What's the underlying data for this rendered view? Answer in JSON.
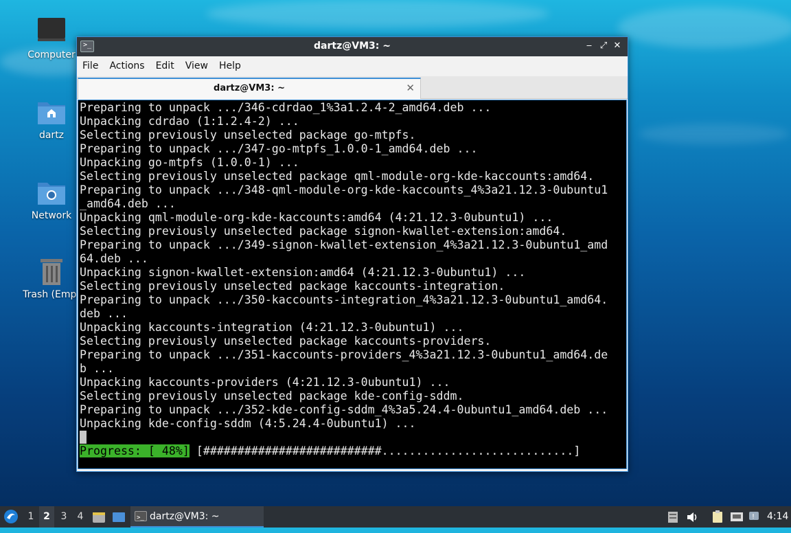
{
  "desktop": {
    "icons": [
      {
        "label": "Computer"
      },
      {
        "label": "dartz"
      },
      {
        "label": "Network"
      },
      {
        "label": "Trash (Empt"
      }
    ]
  },
  "window": {
    "title": "dartz@VM3: ~",
    "menu": [
      "File",
      "Actions",
      "Edit",
      "View",
      "Help"
    ],
    "tab_title": "dartz@VM3: ~",
    "controls": {
      "minimize": "‒",
      "maximize": "⤢",
      "close": "✕"
    }
  },
  "terminal": {
    "lines": [
      "Preparing to unpack .../346-cdrdao_1%3a1.2.4-2_amd64.deb ...",
      "Unpacking cdrdao (1:1.2.4-2) ...",
      "Selecting previously unselected package go-mtpfs.",
      "Preparing to unpack .../347-go-mtpfs_1.0.0-1_amd64.deb ...",
      "Unpacking go-mtpfs (1.0.0-1) ...",
      "Selecting previously unselected package qml-module-org-kde-kaccounts:amd64.",
      "Preparing to unpack .../348-qml-module-org-kde-kaccounts_4%3a21.12.3-0ubuntu1",
      "_amd64.deb ...",
      "Unpacking qml-module-org-kde-kaccounts:amd64 (4:21.12.3-0ubuntu1) ...",
      "Selecting previously unselected package signon-kwallet-extension:amd64.",
      "Preparing to unpack .../349-signon-kwallet-extension_4%3a21.12.3-0ubuntu1_amd",
      "64.deb ...",
      "Unpacking signon-kwallet-extension:amd64 (4:21.12.3-0ubuntu1) ...",
      "Selecting previously unselected package kaccounts-integration.",
      "Preparing to unpack .../350-kaccounts-integration_4%3a21.12.3-0ubuntu1_amd64.",
      "deb ...",
      "Unpacking kaccounts-integration (4:21.12.3-0ubuntu1) ...",
      "Selecting previously unselected package kaccounts-providers.",
      "Preparing to unpack .../351-kaccounts-providers_4%3a21.12.3-0ubuntu1_amd64.de",
      "b ...",
      "Unpacking kaccounts-providers (4:21.12.3-0ubuntu1) ...",
      "Selecting previously unselected package kde-config-sddm.",
      "Preparing to unpack .../352-kde-config-sddm_4%3a5.24.4-0ubuntu1_amd64.deb ...",
      "Unpacking kde-config-sddm (4:5.24.4-0ubuntu1) ..."
    ],
    "progress_label": "Progress: [ 48%]",
    "progress_bar": " [##########################............................]"
  },
  "taskbar": {
    "workspaces": [
      "1",
      "2",
      "3",
      "4"
    ],
    "active_workspace": "2",
    "task_label": "dartz@VM3: ~",
    "clock": "4:14"
  }
}
